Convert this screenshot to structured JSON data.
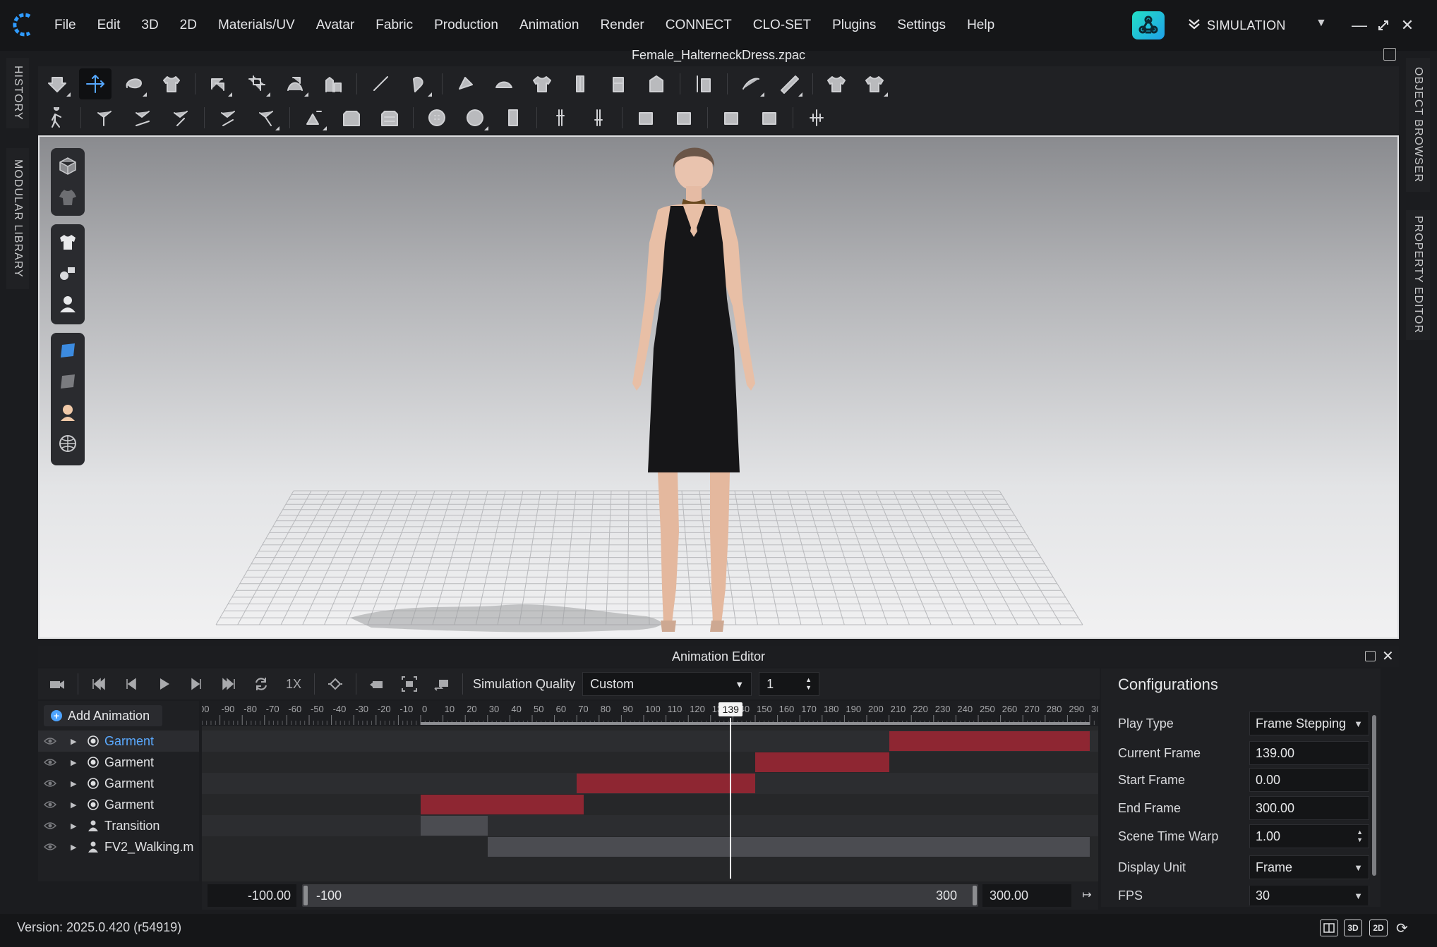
{
  "menu": [
    "File",
    "Edit",
    "3D",
    "2D",
    "Materials/UV",
    "Avatar",
    "Fabric",
    "Production",
    "Animation",
    "Render",
    "CONNECT",
    "CLO-SET",
    "Plugins",
    "Settings",
    "Help"
  ],
  "mode": {
    "label": "SIMULATION"
  },
  "window": {
    "title": "Female_HalterneckDress.zpac"
  },
  "side_tabs": {
    "left": [
      "HISTORY",
      "MODULAR LIBRARY"
    ],
    "right": [
      "OBJECT BROWSER",
      "PROPERTY EDITOR"
    ]
  },
  "animation_editor": {
    "title": "Animation Editor",
    "speed_label": "1X",
    "simulation_quality_label": "Simulation Quality",
    "simulation_quality_value": "Custom",
    "step_value": "1",
    "add_animation_label": "Add Animation",
    "tracks": [
      {
        "name": "Garment",
        "type": "garment",
        "selected": true
      },
      {
        "name": "Garment",
        "type": "garment",
        "selected": false
      },
      {
        "name": "Garment",
        "type": "garment",
        "selected": false
      },
      {
        "name": "Garment",
        "type": "garment",
        "selected": false
      },
      {
        "name": "Transition",
        "type": "avatar",
        "selected": false
      },
      {
        "name": "FV2_Walking.m",
        "type": "avatar",
        "selected": false
      }
    ],
    "ruler_ticks": [
      "00",
      "-90",
      "-80",
      "-70",
      "-60",
      "-50",
      "-40",
      "-30",
      "-20",
      "-10",
      "0",
      "10",
      "20",
      "30",
      "40",
      "50",
      "60",
      "70",
      "80",
      "90",
      "100",
      "110",
      "120",
      "130",
      "140",
      "150",
      "160",
      "170",
      "180",
      "190",
      "200",
      "210",
      "220",
      "230",
      "240",
      "250",
      "260",
      "270",
      "280",
      "290",
      "30"
    ],
    "playhead_frame": "139",
    "clips": [
      {
        "lane": 0,
        "start": 210,
        "end": 300,
        "color": "#8e2632"
      },
      {
        "lane": 1,
        "start": 150,
        "end": 210,
        "color": "#8e2632"
      },
      {
        "lane": 2,
        "start": 70,
        "end": 150,
        "color": "#8e2632"
      },
      {
        "lane": 3,
        "start": 0,
        "end": 73,
        "color": "#8e2632"
      },
      {
        "lane": 4,
        "start": 0,
        "end": 30,
        "color": "#4b4c51"
      },
      {
        "lane": 5,
        "start": 30,
        "end": 300,
        "color": "#4b4c51"
      }
    ],
    "range": {
      "start_value": "-100.00",
      "min_label": "-100",
      "max_label": "300",
      "end_value": "300.00"
    }
  },
  "configurations": {
    "title": "Configurations",
    "rows": [
      {
        "label": "Play Type",
        "value": "Frame Stepping",
        "dropdown": true
      },
      {
        "label": "Current Frame",
        "value": "139.00",
        "dropdown": false
      },
      {
        "label": "Start Frame",
        "value": "0.00",
        "dropdown": false
      },
      {
        "label": "End Frame",
        "value": "300.00",
        "dropdown": false
      },
      {
        "label": "Scene Time Warp",
        "value": "1.00",
        "spinner": true
      },
      {
        "label": "Display Unit",
        "value": "Frame",
        "dropdown": true
      },
      {
        "label": "FPS",
        "value": "30",
        "dropdown": true
      }
    ]
  },
  "status": {
    "version": "Version: 2025.0.420 (r54919)",
    "view_buttons": [
      "3D",
      "2D"
    ]
  },
  "colors": {
    "accent_blue": "#5aa9ff",
    "clip_red": "#8e2632",
    "clip_gray": "#4b4c51"
  }
}
